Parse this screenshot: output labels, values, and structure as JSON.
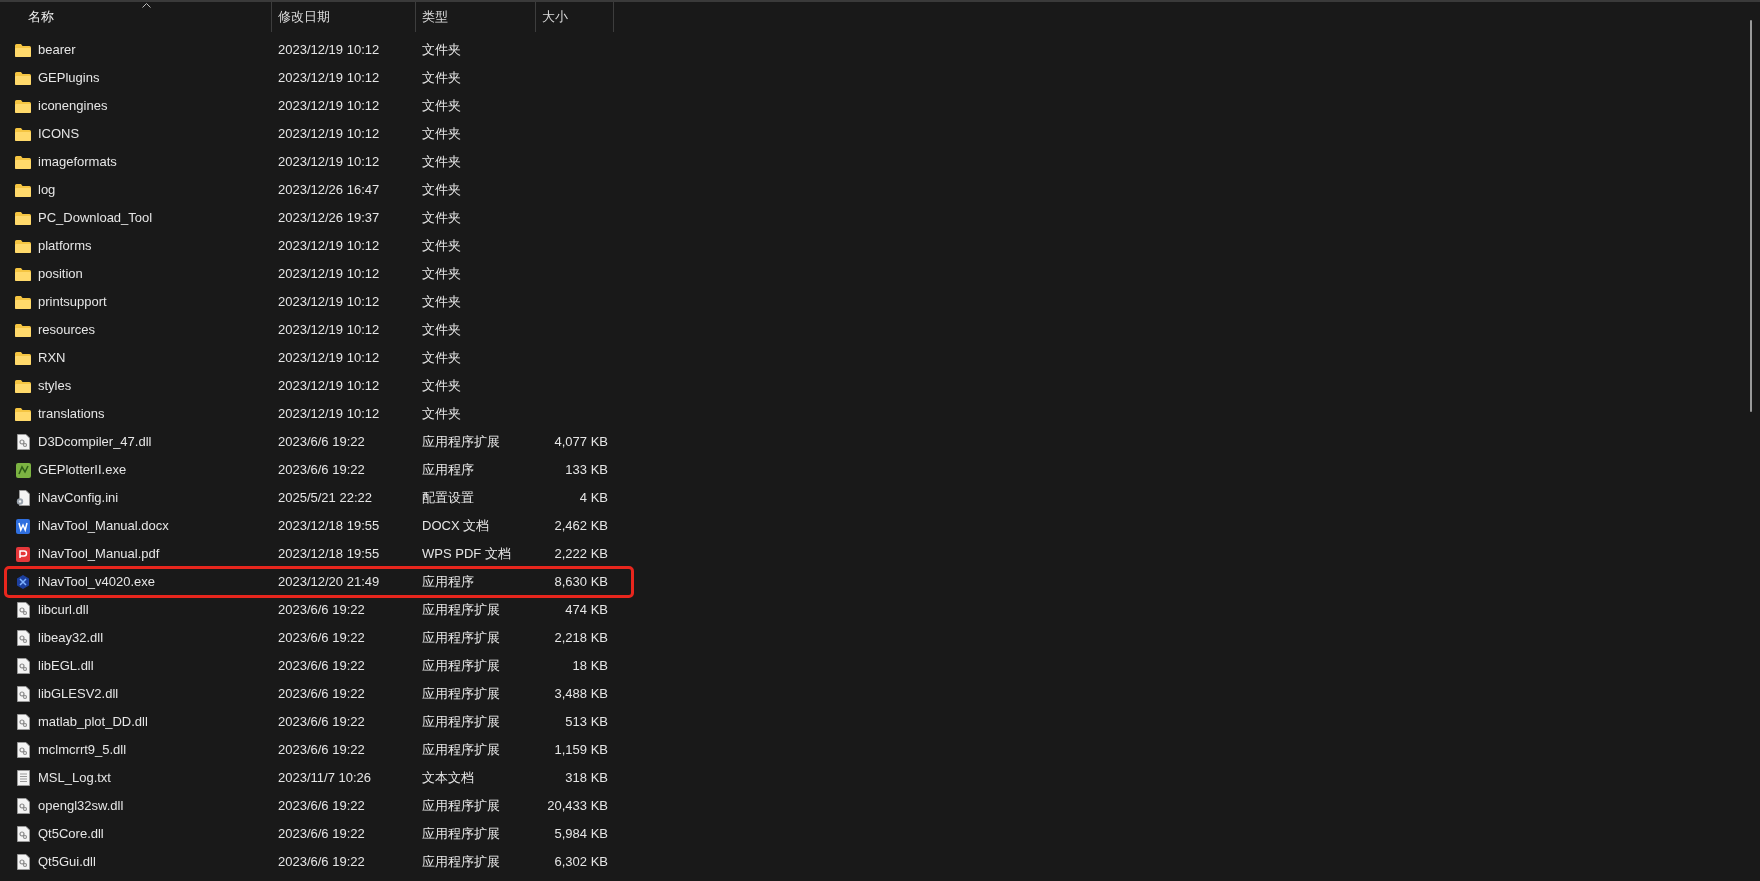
{
  "columns": [
    {
      "label": "名称",
      "sorted": true
    },
    {
      "label": "修改日期",
      "sorted": false
    },
    {
      "label": "类型",
      "sorted": false
    },
    {
      "label": "大小",
      "sorted": false
    }
  ],
  "files": [
    {
      "name": "bearer",
      "modified": "2023/12/19 10:12",
      "type": "文件夹",
      "kind": "folder",
      "highlighted": false
    },
    {
      "name": "GEPlugins",
      "modified": "2023/12/19 10:12",
      "type": "文件夹",
      "kind": "folder",
      "highlighted": false
    },
    {
      "name": "iconengines",
      "modified": "2023/12/19 10:12",
      "type": "文件夹",
      "kind": "folder",
      "highlighted": false
    },
    {
      "name": "ICONS",
      "modified": "2023/12/19 10:12",
      "type": "文件夹",
      "kind": "folder",
      "highlighted": false
    },
    {
      "name": "imageformats",
      "modified": "2023/12/19 10:12",
      "type": "文件夹",
      "kind": "folder",
      "highlighted": false
    },
    {
      "name": "log",
      "modified": "2023/12/26 16:47",
      "type": "文件夹",
      "kind": "folder",
      "highlighted": false
    },
    {
      "name": "PC_Download_Tool",
      "modified": "2023/12/26 19:37",
      "type": "文件夹",
      "kind": "folder",
      "highlighted": false
    },
    {
      "name": "platforms",
      "modified": "2023/12/19 10:12",
      "type": "文件夹",
      "kind": "folder",
      "highlighted": false
    },
    {
      "name": "position",
      "modified": "2023/12/19 10:12",
      "type": "文件夹",
      "kind": "folder",
      "highlighted": false
    },
    {
      "name": "printsupport",
      "modified": "2023/12/19 10:12",
      "type": "文件夹",
      "kind": "folder",
      "highlighted": false
    },
    {
      "name": "resources",
      "modified": "2023/12/19 10:12",
      "type": "文件夹",
      "kind": "folder",
      "highlighted": false
    },
    {
      "name": "RXN",
      "modified": "2023/12/19 10:12",
      "type": "文件夹",
      "kind": "folder",
      "highlighted": false
    },
    {
      "name": "styles",
      "modified": "2023/12/19 10:12",
      "type": "文件夹",
      "kind": "folder",
      "highlighted": false
    },
    {
      "name": "translations",
      "modified": "2023/12/19 10:12",
      "type": "文件夹",
      "kind": "folder",
      "highlighted": false
    },
    {
      "name": "D3Dcompiler_47.dll",
      "modified": "2023/6/6 19:22",
      "type": "应用程序扩展",
      "size": "4,077 KB",
      "kind": "dll",
      "highlighted": false
    },
    {
      "name": "GEPlotterII.exe",
      "modified": "2023/6/6 19:22",
      "type": "应用程序",
      "size": "133 KB",
      "kind": "app",
      "highlighted": false
    },
    {
      "name": "iNavConfig.ini",
      "modified": "2025/5/21 22:22",
      "type": "配置设置",
      "size": "4 KB",
      "kind": "ini",
      "highlighted": false
    },
    {
      "name": "iNavTool_Manual.docx",
      "modified": "2023/12/18 19:55",
      "type": "DOCX 文档",
      "size": "2,462 KB",
      "kind": "docx",
      "highlighted": false
    },
    {
      "name": "iNavTool_Manual.pdf",
      "modified": "2023/12/18 19:55",
      "type": "WPS PDF 文档",
      "size": "2,222 KB",
      "kind": "pdf",
      "highlighted": false
    },
    {
      "name": "iNavTool_v4020.exe",
      "modified": "2023/12/20 21:49",
      "type": "应用程序",
      "size": "8,630 KB",
      "kind": "exe",
      "highlighted": true
    },
    {
      "name": "libcurl.dll",
      "modified": "2023/6/6 19:22",
      "type": "应用程序扩展",
      "size": "474 KB",
      "kind": "dll",
      "highlighted": false
    },
    {
      "name": "libeay32.dll",
      "modified": "2023/6/6 19:22",
      "type": "应用程序扩展",
      "size": "2,218 KB",
      "kind": "dll",
      "highlighted": false
    },
    {
      "name": "libEGL.dll",
      "modified": "2023/6/6 19:22",
      "type": "应用程序扩展",
      "size": "18 KB",
      "kind": "dll",
      "highlighted": false
    },
    {
      "name": "libGLESV2.dll",
      "modified": "2023/6/6 19:22",
      "type": "应用程序扩展",
      "size": "3,488 KB",
      "kind": "dll",
      "highlighted": false
    },
    {
      "name": "matlab_plot_DD.dll",
      "modified": "2023/6/6 19:22",
      "type": "应用程序扩展",
      "size": "513 KB",
      "kind": "dll",
      "highlighted": false
    },
    {
      "name": "mclmcrrt9_5.dll",
      "modified": "2023/6/6 19:22",
      "type": "应用程序扩展",
      "size": "1,159 KB",
      "kind": "dll",
      "highlighted": false
    },
    {
      "name": "MSL_Log.txt",
      "modified": "2023/11/7 10:26",
      "type": "文本文档",
      "size": "318 KB",
      "kind": "txt",
      "highlighted": false
    },
    {
      "name": "opengl32sw.dll",
      "modified": "2023/6/6 19:22",
      "type": "应用程序扩展",
      "size": "20,433 KB",
      "kind": "dll",
      "highlighted": false
    },
    {
      "name": "Qt5Core.dll",
      "modified": "2023/6/6 19:22",
      "type": "应用程序扩展",
      "size": "5,984 KB",
      "kind": "dll",
      "highlighted": false
    },
    {
      "name": "Qt5Gui.dll",
      "modified": "2023/6/6 19:22",
      "type": "应用程序扩展",
      "size": "6,302 KB",
      "kind": "dll",
      "highlighted": false
    }
  ]
}
